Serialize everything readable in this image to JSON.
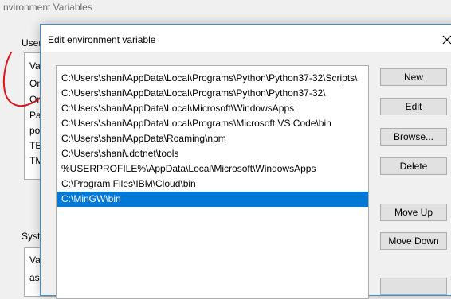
{
  "background_window": {
    "title": "nvironment Variables",
    "user_group_label": "User",
    "user_rows": [
      "Va",
      "On",
      "On",
      "Pa",
      "po",
      "TE",
      "TM"
    ],
    "system_group_label": "Syste",
    "system_rows": [
      "Va",
      "as"
    ]
  },
  "dialog": {
    "title": "Edit environment variable",
    "paths": [
      "C:\\Users\\shani\\AppData\\Local\\Programs\\Python\\Python37-32\\Scripts\\",
      "C:\\Users\\shani\\AppData\\Local\\Programs\\Python\\Python37-32\\",
      "C:\\Users\\shani\\AppData\\Local\\Microsoft\\WindowsApps",
      "C:\\Users\\shani\\AppData\\Local\\Programs\\Microsoft VS Code\\bin",
      "C:\\Users\\shani\\AppData\\Roaming\\npm",
      "C:\\Users\\shani\\.dotnet\\tools",
      "%USERPROFILE%\\AppData\\Local\\Microsoft\\WindowsApps",
      "C:\\Program Files\\IBM\\Cloud\\bin",
      "C:\\MinGW\\bin"
    ],
    "selected_index": 8,
    "buttons": {
      "new": "New",
      "edit": "Edit",
      "browse": "Browse...",
      "delete": "Delete",
      "move_up": "Move Up",
      "move_down": "Move Down"
    }
  },
  "colors": {
    "selection": "#0078d7",
    "annotation": "#e0141e",
    "dialog_border": "#3c8fd8"
  },
  "icons": {
    "close": "close-icon"
  }
}
